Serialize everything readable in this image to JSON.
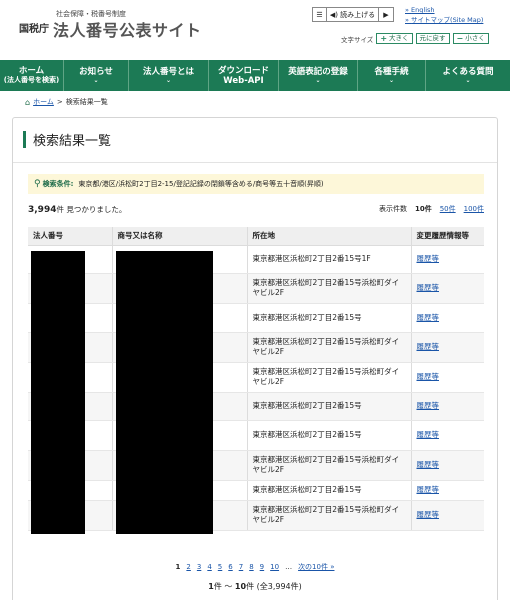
{
  "header": {
    "subtitle": "社会保障・税番号制度",
    "agency": "国税庁",
    "title": "法人番号公表サイト",
    "readspeaker": {
      "menu_icon": "menu-icon",
      "read_label": "読み上げる",
      "play_icon": "play-icon"
    },
    "links": {
      "english": "English",
      "sitemap": "サイトマップ(Site Map)"
    },
    "font_size": {
      "label": "文字サイズ",
      "larger": "大きく",
      "reset": "元に戻す",
      "smaller": "小さく"
    }
  },
  "nav": [
    {
      "l1": "ホーム",
      "l2": "(法人番号を検索)",
      "chev": ""
    },
    {
      "l1": "お知らせ",
      "l2": "",
      "chev": "⌄"
    },
    {
      "l1": "法人番号とは",
      "l2": "",
      "chev": "⌄"
    },
    {
      "l1": "ダウンロード",
      "l2": "Web-API",
      "chev": "⌄"
    },
    {
      "l1": "英語表記の登録",
      "l2": "",
      "chev": "⌄"
    },
    {
      "l1": "各種手続",
      "l2": "",
      "chev": "⌄"
    },
    {
      "l1": "よくある質問",
      "l2": "",
      "chev": "⌄"
    }
  ],
  "breadcrumb": {
    "home": "ホーム",
    "sep": ">",
    "current": "検索結果一覧"
  },
  "page_title": "検索結果一覧",
  "search_condition": {
    "label": "検索条件:",
    "value": "東京都/港区/浜松町2丁目2-15/登記記録の閉鎖等含める/商号等五十音順(昇順)"
  },
  "result_count": {
    "number": "3,994",
    "text": "件 見つかりました。"
  },
  "per_page": {
    "label": "表示件数",
    "current": "10件",
    "opt50": "50件",
    "opt100": "100件"
  },
  "table": {
    "headers": [
      "法人番号",
      "商号又は名称",
      "所在地",
      "変更履歴情報等"
    ],
    "rows": [
      {
        "address": "東京都港区浜松町2丁目2番15号1F",
        "history": "履歴等"
      },
      {
        "address": "東京都港区浜松町2丁目2番15号浜松町ダイヤビル2F",
        "history": "履歴等"
      },
      {
        "address": "東京都港区浜松町2丁目2番15号",
        "history": "履歴等"
      },
      {
        "address": "東京都港区浜松町2丁目2番15号浜松町ダイヤビル2F",
        "history": "履歴等"
      },
      {
        "address": "東京都港区浜松町2丁目2番15号浜松町ダイヤビル2F",
        "history": "履歴等"
      },
      {
        "address": "東京都港区浜松町2丁目2番15号",
        "history": "履歴等"
      },
      {
        "address": "東京都港区浜松町2丁目2番15号",
        "history": "履歴等"
      },
      {
        "address": "東京都港区浜松町2丁目2番15号浜松町ダイヤビル2F",
        "history": "履歴等"
      },
      {
        "address": "東京都港区浜松町2丁目2番15号",
        "history": "履歴等"
      },
      {
        "address": "東京都港区浜松町2丁目2番15号浜松町ダイヤビル2F",
        "history": "履歴等"
      }
    ]
  },
  "pagination": {
    "pages": [
      "1",
      "2",
      "3",
      "4",
      "5",
      "6",
      "7",
      "8",
      "9",
      "10"
    ],
    "current": "1",
    "ellipsis": "…",
    "next": "次の10件 »"
  },
  "summary": {
    "start": "1",
    "mid": "件 ～ ",
    "end": "10",
    "tail": "件 (全3,994件)"
  },
  "colors": {
    "brand": "#1c7a55",
    "condition_bg": "#fdf7d9",
    "link": "#1a55a8"
  }
}
